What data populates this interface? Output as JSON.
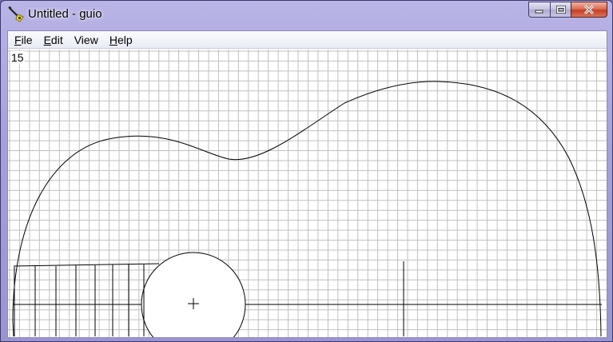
{
  "window": {
    "title": "Untitled - guio",
    "app_icon": "pen-tool-icon",
    "controls": {
      "minimize": "minimize-icon",
      "maximize": "maximize-icon",
      "close": "close-icon"
    }
  },
  "menu": {
    "items": [
      {
        "label": "File",
        "accel": "F",
        "rest": "ile"
      },
      {
        "label": "Edit",
        "accel": "E",
        "rest": "dit"
      },
      {
        "label": "View",
        "accel": "",
        "rest": "View"
      },
      {
        "label": "Help",
        "accel": "H",
        "rest": "elp"
      }
    ]
  },
  "canvas": {
    "scale_value": "15",
    "grid_color": "#c0c0c0",
    "line_color": "#000000"
  }
}
